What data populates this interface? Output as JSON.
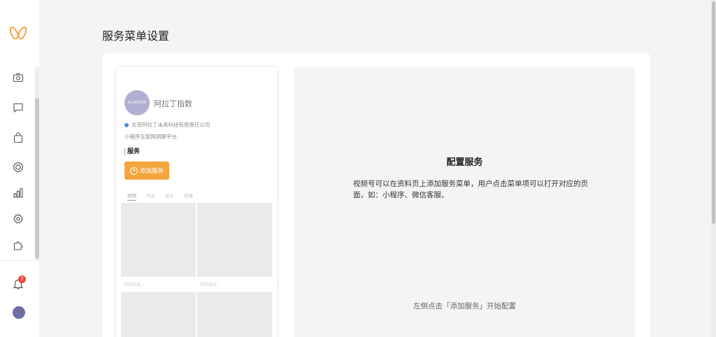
{
  "page": {
    "title": "服务菜单设置"
  },
  "sidebar": {
    "items": [
      {
        "icon": "camera-icon"
      },
      {
        "icon": "message-icon"
      },
      {
        "icon": "shopping-bag-icon"
      },
      {
        "icon": "target-icon"
      },
      {
        "icon": "bar-chart-icon"
      },
      {
        "icon": "gear-icon"
      },
      {
        "icon": "puzzle-icon"
      }
    ],
    "notification_count": "2",
    "accent": "#f3a53e"
  },
  "preview": {
    "account_name": "阿拉丁指数",
    "company": "北京阿拉丁未来科技有限责任公司",
    "description": "小程序互联网洞察平台",
    "section_title": "服务",
    "add_button": "添加服务",
    "tabs": [
      "视频",
      "商品",
      "音乐",
      "直播"
    ],
    "video_captions": [
      "视频描述...",
      "视频描述..."
    ]
  },
  "config": {
    "title": "配置服务",
    "body": "视频号可以在资料页上添加服务菜单，用户点击菜单项可以打开对应的页面，如：小程序、微信客服。",
    "hint": "左侧点击「添加服务」开始配置"
  }
}
